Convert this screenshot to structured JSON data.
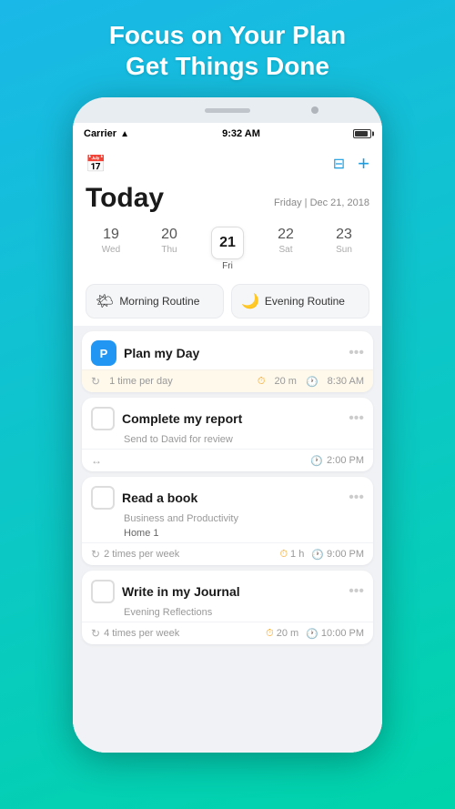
{
  "header": {
    "line1": "Focus on Your Plan",
    "line2": "Get Things Done"
  },
  "status_bar": {
    "carrier": "Carrier",
    "time": "9:32 AM"
  },
  "toolbar": {
    "calendar_icon": "📅",
    "filter_icon": "⊟",
    "add_icon": "+"
  },
  "today": {
    "label": "Today",
    "date": "Friday | Dec 21, 2018"
  },
  "calendar": {
    "days": [
      {
        "num": "19",
        "name": "Wed",
        "active": false
      },
      {
        "num": "20",
        "name": "Thu",
        "active": false
      },
      {
        "num": "21",
        "name": "Fri",
        "active": true
      },
      {
        "num": "22",
        "name": "Sat",
        "active": false
      },
      {
        "num": "23",
        "name": "Sun",
        "active": false
      }
    ]
  },
  "routines": [
    {
      "icon": "🌤",
      "label": "Morning Routine"
    },
    {
      "icon": "🌙",
      "label": "Evening Routine"
    }
  ],
  "tasks": [
    {
      "type": "badge",
      "badge_text": "P",
      "badge_color": "#2196F3",
      "title": "Plan my Day",
      "has_meta_highlight": true,
      "frequency": "1 time per day",
      "duration": "20 m",
      "time": "8:30 AM"
    },
    {
      "type": "checkbox",
      "title": "Complete my report",
      "subtitle": "Send to David for review",
      "has_meta_plain": true,
      "has_arrow": true,
      "time": "2:00 PM"
    },
    {
      "type": "checkbox",
      "title": "Read a book",
      "subtitle": "Business and Productivity",
      "tag": "Home 1",
      "has_meta_plain": true,
      "frequency": "2 times per week",
      "duration": "1 h",
      "time": "9:00 PM"
    },
    {
      "type": "checkbox",
      "title": "Write in my Journal",
      "subtitle": "Evening Reflections",
      "has_meta_plain": true,
      "frequency": "4 times per week",
      "duration": "20 m",
      "time": "10:00 PM"
    }
  ]
}
